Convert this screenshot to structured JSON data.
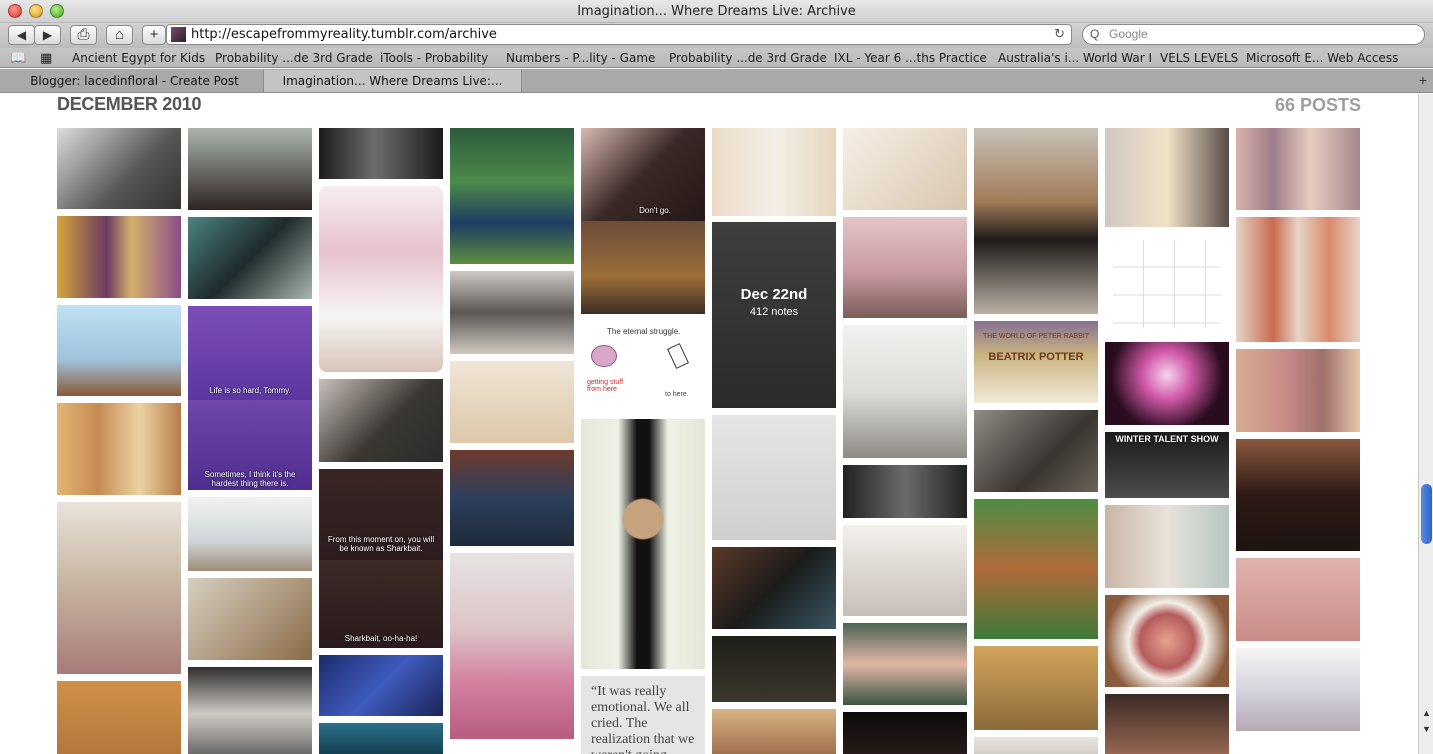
{
  "window": {
    "title": "Imagination... Where Dreams Live: Archive"
  },
  "toolbar": {
    "back": "◀",
    "forward": "▶",
    "print": "⎙",
    "home": "⌂",
    "add": "+",
    "url": "http://escapefrommyreality.tumblr.com/archive",
    "reload": "↻",
    "search_placeholder": "Google",
    "search_icon": "Q"
  },
  "bookmarks": [
    "Ancient Egypt for Kids",
    "Probability ...de 3rd Grade",
    "iTools - Probability",
    "Numbers - P...lity - Game",
    "Probability ...de 3rd Grade",
    "IXL - Year 6 ...ths Practice",
    "Australia's i... World War I",
    "VELS LEVELS",
    "Microsoft E... Web Access"
  ],
  "tabs": [
    {
      "label": "Blogger: lacedinfloral - Create Post"
    },
    {
      "label": "Imagination... Where Dreams Live:..."
    }
  ],
  "archive": {
    "month": "DECEMBER 2010",
    "count": "66 POSTS",
    "hover_date": "Dec 22nd",
    "hover_notes": "412 notes",
    "quote": "“It was really emotional. We all cried. The realization that we weren't going",
    "captions": {
      "dont_go": "Don't go.",
      "life_hard": "Life is so hard, Tommy.",
      "hardest": "Sometimes, I think it's the hardest thing there is.",
      "sharkbait": "From this moment on, you will be known as Sharkbait.",
      "sharkbait2": "Sharkbait, oo-ha-ha!",
      "struggle": "The eternal struggle.",
      "getting_stuff": "getting stuff from here",
      "to_here": "to here.",
      "winter": "WINTER TALENT SHOW",
      "beatrix": "BEATRIX POTTER",
      "world_of": "THE WORLD OF PETER RABBIT"
    }
  }
}
